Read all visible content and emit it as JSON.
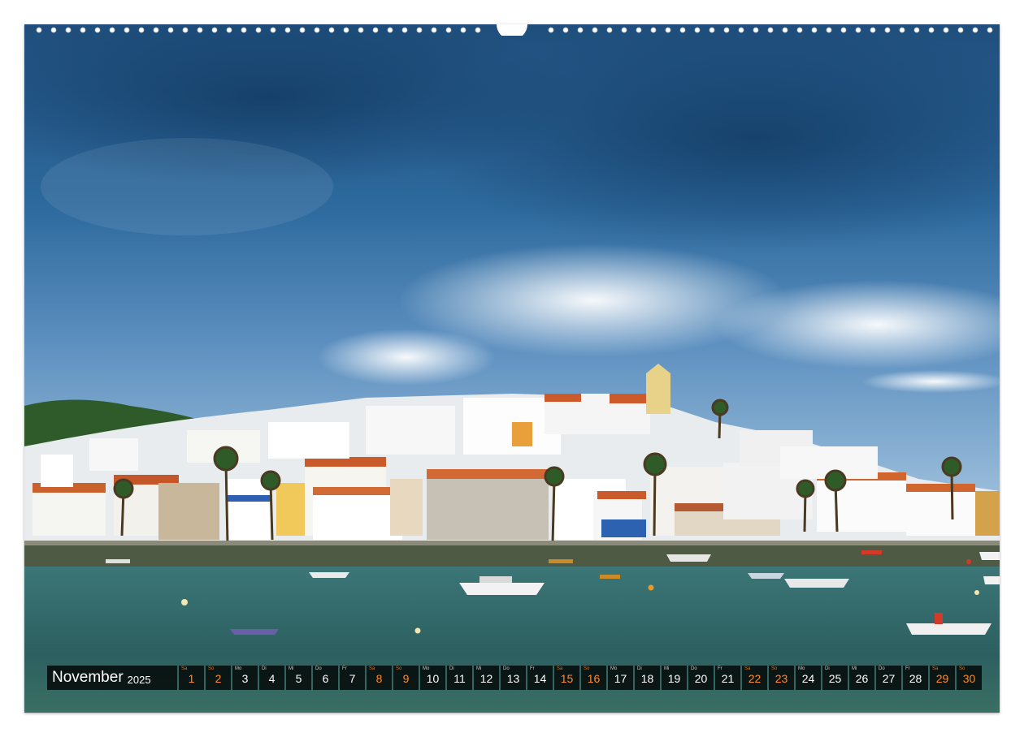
{
  "calendar": {
    "month": "November",
    "year": "2025",
    "days": [
      {
        "dn": "Sa",
        "num": "1",
        "weekend": true
      },
      {
        "dn": "So",
        "num": "2",
        "weekend": true
      },
      {
        "dn": "Mo",
        "num": "3",
        "weekend": false
      },
      {
        "dn": "Di",
        "num": "4",
        "weekend": false
      },
      {
        "dn": "Mi",
        "num": "5",
        "weekend": false
      },
      {
        "dn": "Do",
        "num": "6",
        "weekend": false
      },
      {
        "dn": "Fr",
        "num": "7",
        "weekend": false
      },
      {
        "dn": "Sa",
        "num": "8",
        "weekend": true
      },
      {
        "dn": "So",
        "num": "9",
        "weekend": true
      },
      {
        "dn": "Mo",
        "num": "10",
        "weekend": false
      },
      {
        "dn": "Di",
        "num": "11",
        "weekend": false
      },
      {
        "dn": "Mi",
        "num": "12",
        "weekend": false
      },
      {
        "dn": "Do",
        "num": "13",
        "weekend": false
      },
      {
        "dn": "Fr",
        "num": "14",
        "weekend": false
      },
      {
        "dn": "Sa",
        "num": "15",
        "weekend": true
      },
      {
        "dn": "So",
        "num": "16",
        "weekend": true
      },
      {
        "dn": "Mo",
        "num": "17",
        "weekend": false
      },
      {
        "dn": "Di",
        "num": "18",
        "weekend": false
      },
      {
        "dn": "Mi",
        "num": "19",
        "weekend": false
      },
      {
        "dn": "Do",
        "num": "20",
        "weekend": false
      },
      {
        "dn": "Fr",
        "num": "21",
        "weekend": false
      },
      {
        "dn": "Sa",
        "num": "22",
        "weekend": true
      },
      {
        "dn": "So",
        "num": "23",
        "weekend": true
      },
      {
        "dn": "Mo",
        "num": "24",
        "weekend": false
      },
      {
        "dn": "Di",
        "num": "25",
        "weekend": false
      },
      {
        "dn": "Mi",
        "num": "26",
        "weekend": false
      },
      {
        "dn": "Do",
        "num": "27",
        "weekend": false
      },
      {
        "dn": "Fr",
        "num": "28",
        "weekend": false
      },
      {
        "dn": "Sa",
        "num": "29",
        "weekend": true
      },
      {
        "dn": "So",
        "num": "30",
        "weekend": true
      }
    ]
  },
  "colors": {
    "weekend": "#ff8c2a",
    "bar": "#1a1a1a",
    "sky_top": "#24537f",
    "sky_bottom": "#a7c5de",
    "water": "#2f6567"
  }
}
